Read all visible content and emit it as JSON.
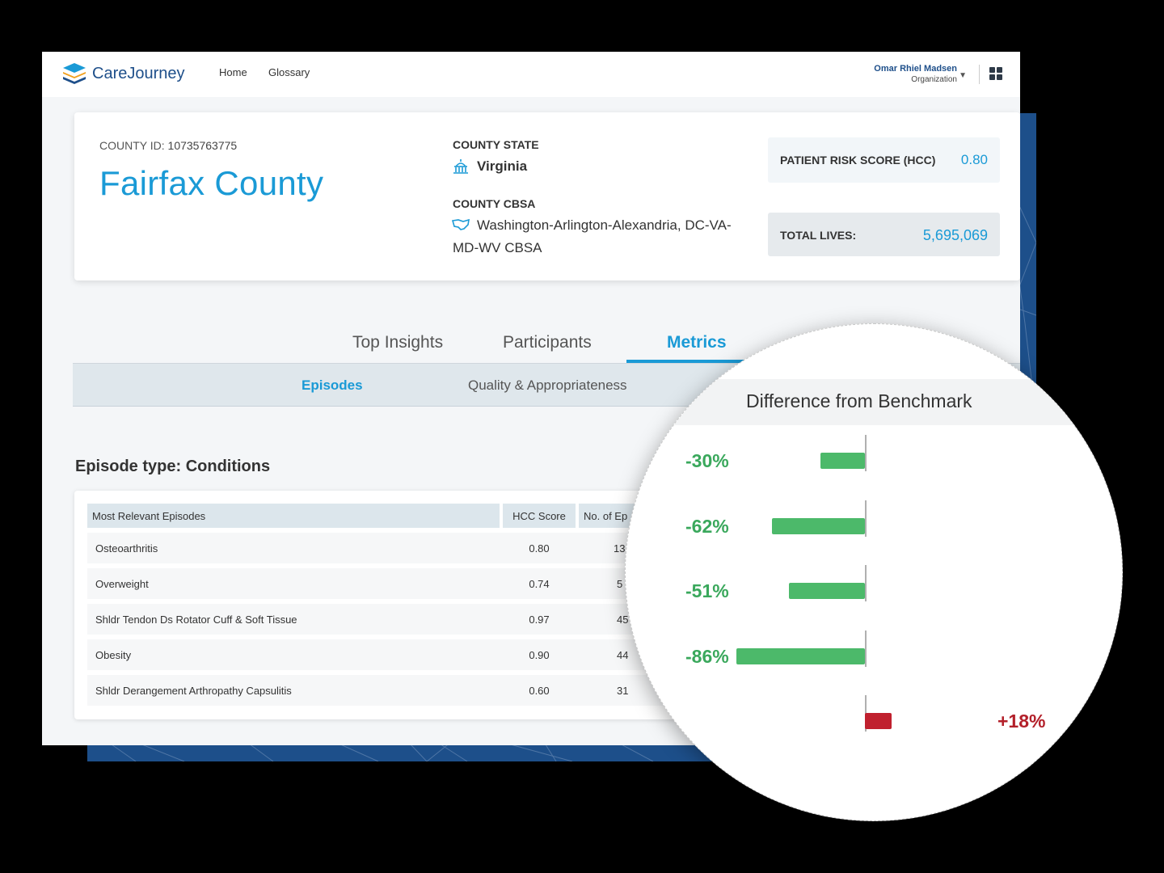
{
  "app": {
    "logo_text": "CareJourney",
    "nav": [
      "Home",
      "Glossary"
    ],
    "user_name": "Omar Rhiel Madsen",
    "user_role": "Organization"
  },
  "county": {
    "id_label": "COUNTY ID:",
    "id_value": "10735763775",
    "name": "Fairfax County",
    "state_label": "COUNTY STATE",
    "state_value": "Virginia",
    "cbsa_label": "COUNTY CBSA",
    "cbsa_line1": "Washington-Arlington-Alexandria, DC-VA-",
    "cbsa_line2": "MD-WV CBSA",
    "risk_label": "PATIENT RISK SCORE (HCC)",
    "risk_value": "0.80",
    "lives_label": "TOTAL LIVES:",
    "lives_value": "5,695,069"
  },
  "tabs": [
    "Top Insights",
    "Participants",
    "Metrics"
  ],
  "active_tab": "Metrics",
  "subtabs": [
    "Episodes",
    "Quality & Appropriateness"
  ],
  "active_subtab": "Episodes",
  "section_title": "Episode type: Conditions",
  "table": {
    "headers": [
      "Most Relevant Episodes",
      "HCC Score",
      "No. of Ep"
    ],
    "rows": [
      {
        "episode": "Osteoarthritis",
        "hcc": "0.80",
        "count": "13"
      },
      {
        "episode": "Overweight",
        "hcc": "0.74",
        "count": "5"
      },
      {
        "episode": "Shldr Tendon Ds Rotator Cuff & Soft Tissue",
        "hcc": "0.97",
        "count": "45"
      },
      {
        "episode": "Obesity",
        "hcc": "0.90",
        "count": "44"
      },
      {
        "episode": "Shldr Derangement Arthropathy Capsulitis",
        "hcc": "0.60",
        "count": "31"
      }
    ]
  },
  "benchmark": {
    "title": "Difference from Benchmark",
    "items": [
      {
        "label": "-30%",
        "value": -30
      },
      {
        "label": "-62%",
        "value": -62
      },
      {
        "label": "-51%",
        "value": -51
      },
      {
        "label": "-86%",
        "value": -86
      },
      {
        "label": "+18%",
        "value": 18
      }
    ],
    "colors": {
      "negative": "#4cb96a",
      "positive": "#c0202e",
      "negative_text": "#3aa85c",
      "positive_text": "#b3202a"
    }
  }
}
